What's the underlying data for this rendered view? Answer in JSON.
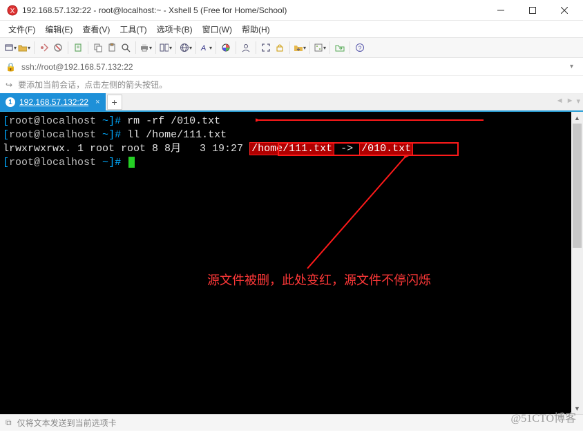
{
  "title": "192.168.57.132:22 - root@localhost:~ - Xshell 5 (Free for Home/School)",
  "menus": {
    "file": "文件(F)",
    "edit": "编辑(E)",
    "view": "查看(V)",
    "tools": "工具(T)",
    "tabs": "选项卡(B)",
    "window": "窗口(W)",
    "help": "帮助(H)"
  },
  "url": "ssh://root@192.168.57.132:22",
  "tip": "要添加当前会话，点击左侧的箭头按钮。",
  "tab": {
    "index": "1",
    "label": "192.168.57.132:22",
    "add": "+"
  },
  "term": {
    "p1_open": "[",
    "p1_host": "root@localhost",
    "p1_sep": " ~",
    "p1_close": "]# ",
    "cmd1": "rm -rf /010.txt",
    "cmd2": "ll /home/111.txt",
    "ls": "lrwxrwxrwx. 1 root root 8 8月   3 19:27 ",
    "link_src": "/home/111.txt",
    "link_arrow": " -> ",
    "link_dst": "/010.txt"
  },
  "annotation": "源文件被删，此处变红，源文件不停闪烁",
  "status": "仅将文本发送到当前选项卡",
  "watermark": "@51CTO博客"
}
